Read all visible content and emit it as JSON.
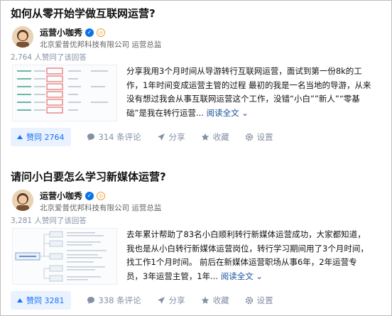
{
  "answers": [
    {
      "question": "如何从零开始学做互联网运营?",
      "author_name": "运营小咖秀",
      "author_headline": "北京爱普优邦科技有限公司 运营总监",
      "votes_line": "2,764 人赞同了该回答",
      "excerpt": "分享我用3个月时间从导游转行互联网运营，面试到第一份8k的工作，1年时间变成运营主管的过程 最初的我是一名当地的导游，从来没有想过我会从事互联网运营这个工作，没错“小白””新人”“零基础”是我在转行运营...",
      "read_more": "阅读全文 ⌄",
      "vote_label": "赞同 2764",
      "comments_label": "314 条评论",
      "share_label": "分享",
      "favorite_label": "收藏",
      "settings_label": "设置"
    },
    {
      "question": "请问小白要怎么学习新媒体运营?",
      "author_name": "运营小咖秀",
      "author_headline": "北京爱普优邦科技有限公司 运营总监",
      "votes_line": "3,281 人赞同了该回答",
      "excerpt": "去年累计帮助了83名小白顺利转行新媒体运营成功，大家都知道，我也是从小白转行新媒体运营岗位，转行学习期间用了3个月时间，找工作1个月时间。 前后在新媒体运营职场从事6年，2年运营专员，3年运营主管，1年...",
      "read_more": "阅读全文 ⌄",
      "vote_label": "赞同 3281",
      "comments_label": "338 条评论",
      "share_label": "分享",
      "favorite_label": "收藏",
      "settings_label": "设置"
    }
  ],
  "colors": {
    "accent": "#1772f6",
    "vote_bg": "#eaf2ff",
    "meta": "#8590a6",
    "link": "#175199",
    "verified": "#0a73e8",
    "highlight_box": "#e0524f"
  },
  "icons": [
    "verified-badge-icon",
    "org-badge-icon",
    "upvote-arrow-icon",
    "comment-icon",
    "share-icon",
    "star-icon",
    "gear-icon"
  ]
}
